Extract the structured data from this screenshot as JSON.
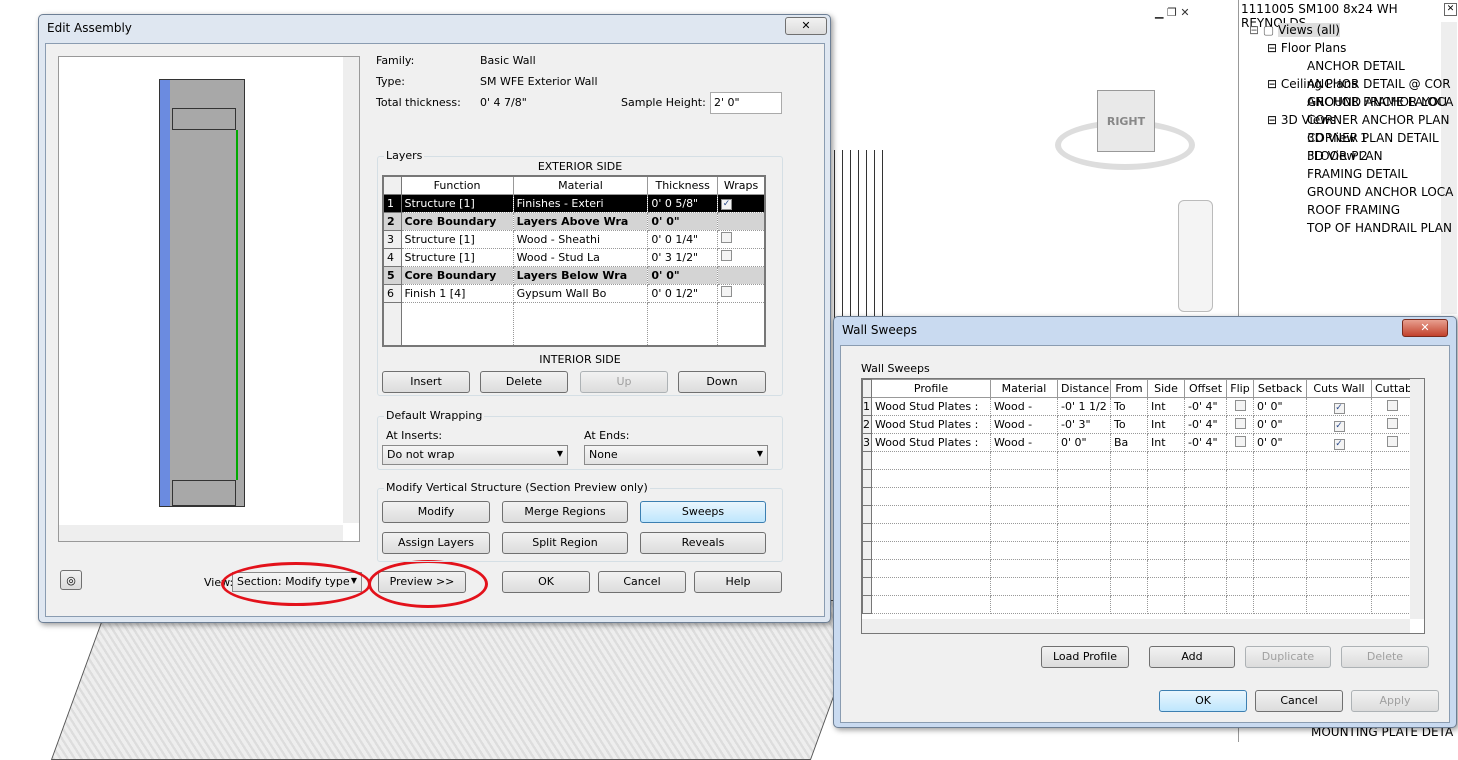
{
  "browser": {
    "title": "1111005 SM100 8x24 WH REYNOLDS...",
    "root": "Views (all)",
    "floor_plans": "Floor Plans",
    "floor_items": [
      "ANCHOR DETAIL",
      "ANCHOR DETAIL @ COR",
      "ANCHOR FRAME LAYOU",
      "CORNER ANCHOR PLAN",
      "CORNER PLAN DETAIL",
      "FLOOR PLAN",
      "FRAMING DETAIL",
      "GROUND ANCHOR LOCA",
      "ROOF FRAMING",
      "TOP OF HANDRAIL PLAN"
    ],
    "ceiling_plans": "Ceiling Plans",
    "ceiling_items": [
      "GROUND ANCHOR LOCA"
    ],
    "views3d": "3D Views",
    "views3d_items": [
      "3D View 1",
      "3D View 2"
    ],
    "bottom_item": "MOUNTING PLATE DETA"
  },
  "viewcube": {
    "face": "RIGHT"
  },
  "edit": {
    "title": "Edit Assembly",
    "family_label": "Family:",
    "family": "Basic Wall",
    "type_label": "Type:",
    "type": "SM WFE Exterior Wall",
    "thickness_label": "Total thickness:",
    "thickness": "0'  4 7/8\"",
    "sample_label": "Sample Height:",
    "sample": "2'  0\"",
    "layers_label": "Layers",
    "exterior": "EXTERIOR SIDE",
    "interior": "INTERIOR SIDE",
    "columns": [
      "Function",
      "Material",
      "Thickness",
      "Wraps"
    ],
    "rows": [
      {
        "n": "1",
        "f": "Structure [1]",
        "m": "Finishes - Exteri",
        "t": "0'  0 5/8\"",
        "w": "checked"
      },
      {
        "n": "2",
        "f": "Core Boundary",
        "m": "Layers Above Wra",
        "t": "0'  0\"",
        "w": "none"
      },
      {
        "n": "3",
        "f": "Structure [1]",
        "m": "Wood - Sheathi",
        "t": "0'  0 1/4\"",
        "w": "unchecked"
      },
      {
        "n": "4",
        "f": "Structure [1]",
        "m": "Wood - Stud La",
        "t": "0'  3 1/2\"",
        "w": "unchecked"
      },
      {
        "n": "5",
        "f": "Core Boundary",
        "m": "Layers Below Wra",
        "t": "0'  0\"",
        "w": "none"
      },
      {
        "n": "6",
        "f": "Finish 1 [4]",
        "m": "Gypsum Wall Bo",
        "t": "0'  0 1/2\"",
        "w": "unchecked"
      }
    ],
    "insert": "Insert",
    "delete": "Delete",
    "up": "Up",
    "down": "Down",
    "wrapping_label": "Default Wrapping",
    "at_inserts": "At Inserts:",
    "at_inserts_val": "Do not wrap",
    "at_ends": "At Ends:",
    "at_ends_val": "None",
    "mvs_label": "Modify Vertical Structure (Section Preview only)",
    "modify": "Modify",
    "merge": "Merge Regions",
    "sweeps": "Sweeps",
    "assign": "Assign Layers",
    "split": "Split Region",
    "reveals": "Reveals",
    "view_label": "View:",
    "view_val": "Section: Modify type",
    "preview": "Preview >>",
    "ok": "OK",
    "cancel": "Cancel",
    "help": "Help"
  },
  "sweeps": {
    "title": "Wall Sweeps",
    "group": "Wall Sweeps",
    "columns": [
      "Profile",
      "Material",
      "Distance",
      "From",
      "Side",
      "Offset",
      "Flip",
      "Setback",
      "Cuts Wall",
      "Cuttab"
    ],
    "rows": [
      {
        "n": "1",
        "p": "Wood Stud Plates :",
        "m": "Wood -",
        "d": "-0'  1 1/2",
        "f": "To",
        "s": "Int",
        "o": "-0'  4\"",
        "b": "0'  0\""
      },
      {
        "n": "2",
        "p": "Wood Stud Plates :",
        "m": "Wood -",
        "d": "-0'  3\"",
        "f": "To",
        "s": "Int",
        "o": "-0'  4\"",
        "b": "0'  0\""
      },
      {
        "n": "3",
        "p": "Wood Stud Plates :",
        "m": "Wood -",
        "d": "0'  0\"",
        "f": "Ba",
        "s": "Int",
        "o": "-0'  4\"",
        "b": "0'  0\""
      }
    ],
    "load": "Load Profile",
    "add": "Add",
    "duplicate": "Duplicate",
    "delete": "Delete",
    "ok": "OK",
    "cancel": "Cancel",
    "apply": "Apply"
  }
}
